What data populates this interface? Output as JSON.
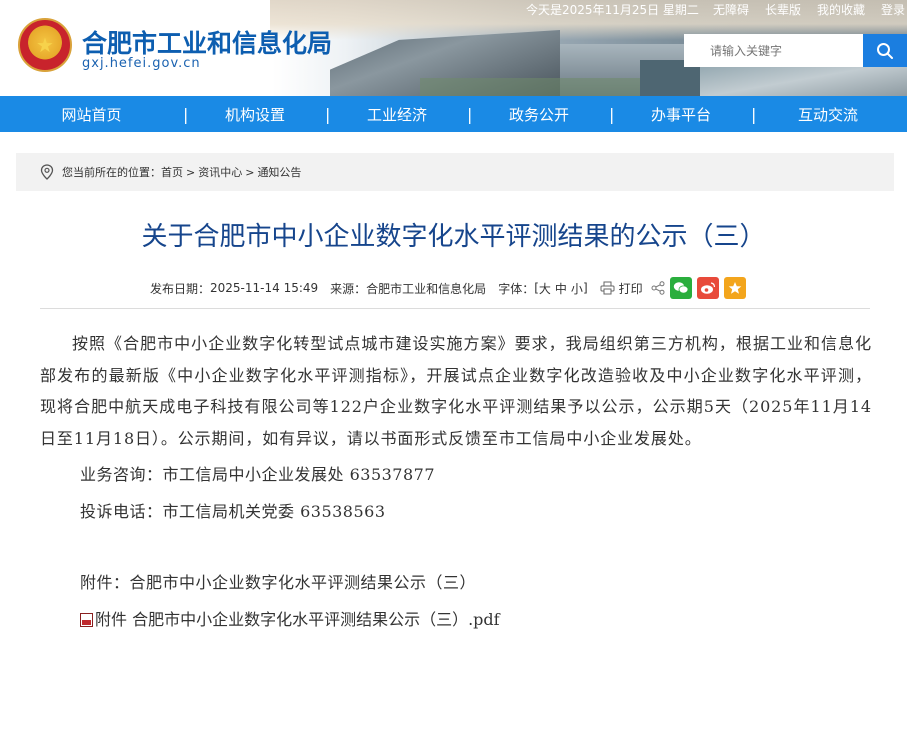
{
  "header": {
    "site_title": "合肥市工业和信息化局",
    "site_domain": "gxj.hefei.gov.cn",
    "date_text": "今天是2025年11月25日 星期二",
    "accessibility": "无障碍",
    "elder_mode": "长辈版",
    "favorites": "我的收藏",
    "login": "登录",
    "search_placeholder": "请输入关键字",
    "search_icon": "search-icon",
    "emblem_icon": "national-emblem-icon"
  },
  "nav": {
    "items": [
      {
        "label": "网站首页"
      },
      {
        "label": "机构设置"
      },
      {
        "label": "工业经济"
      },
      {
        "label": "政务公开"
      },
      {
        "label": "办事平台"
      },
      {
        "label": "互动交流"
      }
    ],
    "separator": "|"
  },
  "breadcrumb": {
    "prefix": "您当前所在的位置：",
    "items": [
      "首页",
      "资讯中心",
      "通知公告"
    ],
    "separator": ">"
  },
  "article": {
    "title": "关于合肥市中小企业数字化水平评测结果的公示（三）",
    "publish_label": "发布日期：",
    "publish_date": "2025-11-14 15:49",
    "source_label": "来源：",
    "source": "合肥市工业和信息化局",
    "font_label": "字体：",
    "font_open": "[",
    "font_large": "大",
    "font_medium": "中",
    "font_small": "小",
    "font_close": "]",
    "print_label": "打印",
    "paragraph": "按照《合肥市中小企业数字化转型试点城市建设实施方案》要求，我局组织第三方机构，根据工业和信息化部发布的最新版《中小企业数字化水平评测指标》，开展试点企业数字化改造验收及中小企业数字化水平评测，现将合肥中航天成电子科技有限公司等122户企业数字化水平评测结果予以公示，公示期5天（2025年11月14日至11月18日）。公示期间，如有异议，请以书面形式反馈至市工信局中小企业发展处。",
    "consult_line": "业务咨询：市工信局中小企业发展处  63537877",
    "complaint_line": "投诉电话：市工信局机关党委  63538563",
    "attachment_line": "附件：合肥市中小企业数字化水平评测结果公示（三）",
    "file_link": "附件 合肥市中小企业数字化水平评测结果公示（三）.pdf"
  },
  "colors": {
    "nav_bg": "#1a8ae5",
    "title_color": "#16458c",
    "brand_blue": "#0d5eb0",
    "search_button": "#1b7ee0"
  }
}
